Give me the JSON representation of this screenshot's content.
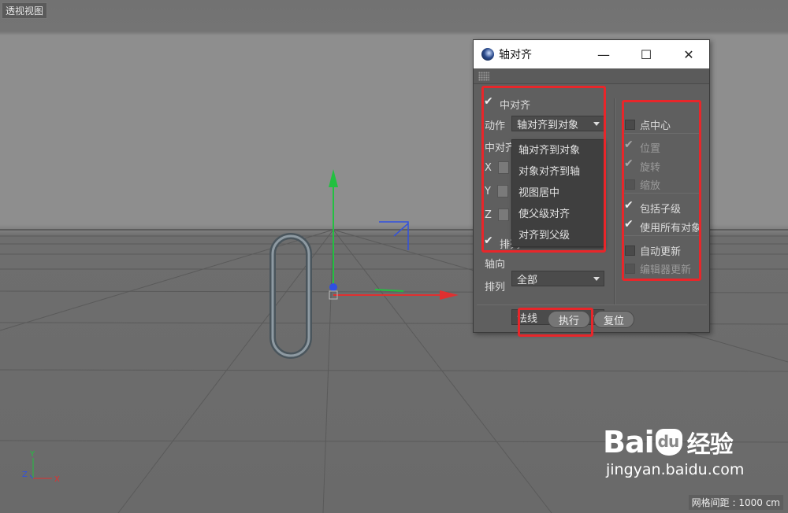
{
  "viewport": {
    "label": "透视视图",
    "axis_x": "X",
    "axis_y": "Y",
    "axis_z": "Z",
    "grid_info": "网格间距 : 1000 cm"
  },
  "dialog": {
    "title": "轴对齐",
    "left": {
      "center_align": {
        "label": "中对齐",
        "checked": true
      },
      "action_label": "动作",
      "action_value": "轴对齐到对象",
      "center_align_label_cut": "中对齐",
      "x_label": "X",
      "y_label": "Y",
      "z_label": "Z",
      "arrange": {
        "label": "排列",
        "checked": true
      },
      "axis_label": "轴向",
      "axis_value": "全部",
      "arrange_label": "排列",
      "arrange_value": "法线"
    },
    "dropdown": {
      "items": [
        "轴对齐到对象",
        "对象对齐到轴",
        "视图居中",
        "使父级对齐",
        "对齐到父级"
      ]
    },
    "right": {
      "point_center": {
        "label": "点中心",
        "checked": false
      },
      "position": {
        "label": "位置",
        "checked": true
      },
      "rotation": {
        "label": "旋转",
        "checked": true
      },
      "scale": {
        "label": "缩放",
        "checked": false
      },
      "include_children": {
        "label": "包括子级",
        "checked": true
      },
      "use_all_objects": {
        "label": "使用所有对象",
        "checked": true
      },
      "auto_update": {
        "label": "自动更新",
        "checked": false
      },
      "editor_update": {
        "label": "编辑器更新",
        "checked": false
      }
    },
    "buttons": {
      "execute": "执行",
      "reset": "复位"
    }
  },
  "watermark": {
    "logo_bai": "Bai",
    "logo_du": "du",
    "logo_cn": "经验",
    "url": "jingyan.baidu.com"
  },
  "colors": {
    "highlight_box": "#e8262a",
    "axis_x": "#e03030",
    "axis_y": "#22c040",
    "axis_z": "#3050e0"
  }
}
